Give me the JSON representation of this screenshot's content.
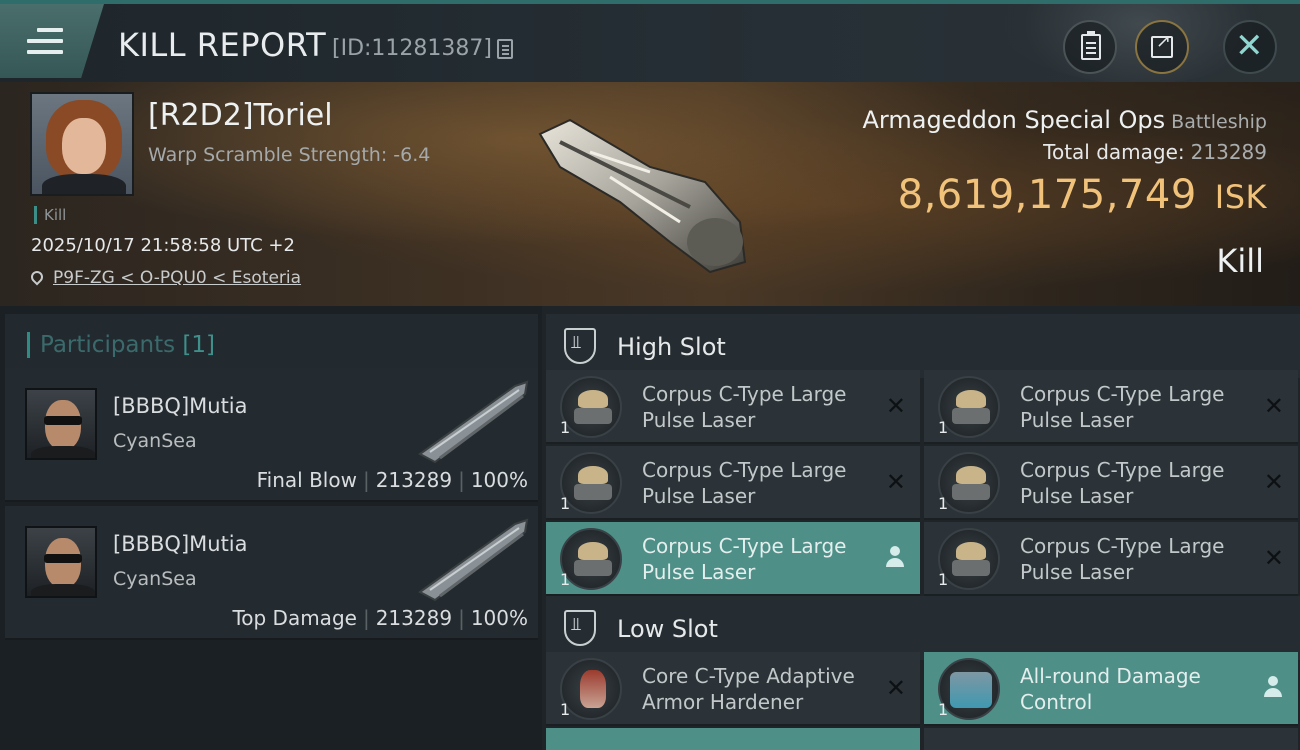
{
  "header": {
    "title": "KILL REPORT",
    "report_id": "[ID:11281387]"
  },
  "victim": {
    "name": "[R2D2]Toriel",
    "warp_scramble": "Warp Scramble Strength: -6.4",
    "tag": "Kill",
    "datetime": "2025/10/17 21:58:58 UTC +2",
    "location": "P9F-ZG < O-PQU0 < Esoteria",
    "ship_name": "Armageddon Special Ops",
    "ship_class": "Battleship",
    "total_damage_label": "Total damage:",
    "total_damage": "213289",
    "isk_value": "8,619,175,749",
    "isk_unit": "ISK",
    "result": "Kill"
  },
  "participants": {
    "label": "Participants",
    "count": "[1]",
    "rows": [
      {
        "name": "[BBBQ]Mutia",
        "corp": "CyanSea",
        "role": "Final Blow",
        "damage": "213289",
        "percent": "100%"
      },
      {
        "name": "[BBBQ]Mutia",
        "corp": "CyanSea",
        "role": "Top Damage",
        "damage": "213289",
        "percent": "100%"
      }
    ]
  },
  "slots": {
    "high_label": "High Slot",
    "low_label": "Low Slot",
    "high": [
      {
        "qty": "1",
        "name": "Corpus C-Type Large Pulse Laser",
        "status": "destroyed"
      },
      {
        "qty": "1",
        "name": "Corpus C-Type Large Pulse Laser",
        "status": "destroyed"
      },
      {
        "qty": "1",
        "name": "Corpus C-Type Large Pulse Laser",
        "status": "destroyed"
      },
      {
        "qty": "1",
        "name": "Corpus C-Type Large Pulse Laser",
        "status": "destroyed"
      },
      {
        "qty": "1",
        "name": "Corpus C-Type Large Pulse Laser",
        "status": "dropped"
      },
      {
        "qty": "1",
        "name": "Corpus C-Type Large Pulse Laser",
        "status": "destroyed"
      }
    ],
    "low": [
      {
        "qty": "1",
        "name": "Core C-Type Adaptive Armor Hardener",
        "status": "destroyed"
      },
      {
        "qty": "1",
        "name": "All-round Damage Control",
        "status": "dropped"
      }
    ]
  },
  "colors": {
    "accent": "#4e8f88",
    "isk": "#f1c27a",
    "header_bar": "#2f6d6a"
  }
}
